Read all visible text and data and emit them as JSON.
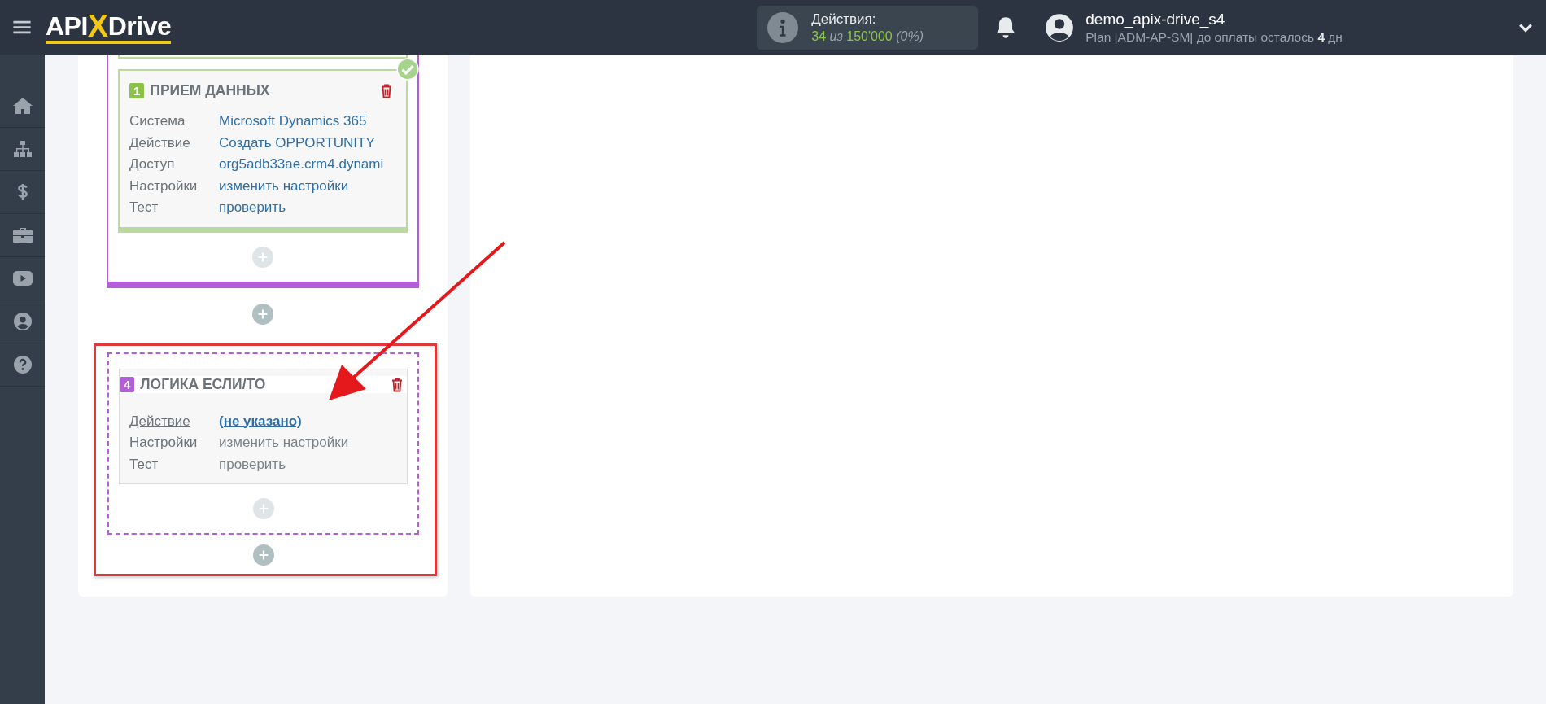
{
  "header": {
    "logo": {
      "prefix": "API",
      "accent": "X",
      "suffix": "Drive"
    },
    "actions": {
      "label": "Действия:",
      "count": "34 *из* 150'000 *(0%)*"
    },
    "user": {
      "name": "demo_apix-drive_s4",
      "plan": "Plan |ADM-AP-SM| до оплаты осталось **4** дн"
    }
  },
  "blocks": [
    {
      "kind": "source",
      "number": "1",
      "color": "#8bc34a",
      "title": "ПРИЕМ ДАННЫХ",
      "done": true,
      "rows": [
        {
          "label": "Система",
          "value": "Microsoft Dynamics 365",
          "kind": "link"
        },
        {
          "label": "Действие",
          "value": "Создать OPPORTUNITY",
          "kind": "link"
        },
        {
          "label": "Доступ",
          "value": "org5adb33ae.crm4.dynami",
          "kind": "link"
        },
        {
          "label": "Настройки",
          "value": "изменить настройки",
          "kind": "link"
        },
        {
          "label": "Тест",
          "value": "проверить",
          "kind": "link"
        }
      ]
    },
    {
      "kind": "logic",
      "number": "4",
      "color": "#b25fd9",
      "title": "ЛОГИКА ЕСЛИ/ТО",
      "done": false,
      "rows": [
        {
          "label": "Действие",
          "value": "(не указано)",
          "kind": "required"
        },
        {
          "label": "Настройки",
          "value": "изменить настройки",
          "kind": "muted"
        },
        {
          "label": "Тест",
          "value": "проверить",
          "kind": "muted"
        }
      ]
    }
  ]
}
